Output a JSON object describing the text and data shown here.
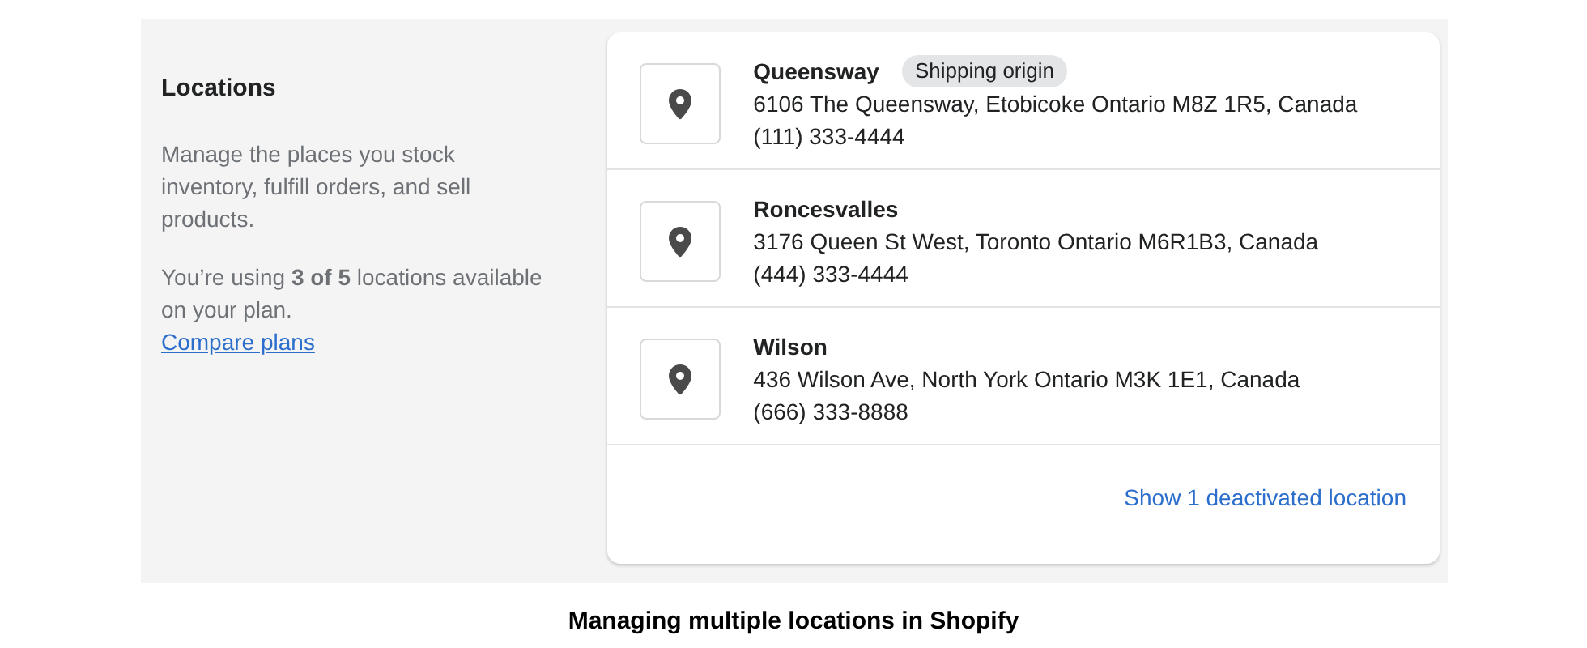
{
  "section": {
    "title": "Locations",
    "description": "Manage the places you stock inventory, fulfill orders, and sell products.",
    "usage": "You’re using **3 of 5** locations available on your plan.",
    "link": "Compare plans"
  },
  "locations": [
    {
      "name": "Queensway",
      "badge": "Shipping origin",
      "address": "6106 The Queensway, Etobicoke Ontario M8Z 1R5, Canada",
      "phone": "(111) 333-4444"
    },
    {
      "name": "Roncesvalles",
      "address": "3176 Queen St West, Toronto Ontario M6R1B3, Canada",
      "phone": "(444) 333-4444"
    },
    {
      "name": "Wilson",
      "address": "436 Wilson Ave, North York Ontario M3K 1E1, Canada",
      "phone": "(666) 333-8888"
    }
  ],
  "footer_link": "Show 1 deactivated location",
  "caption": "Managing multiple locations in Shopify"
}
